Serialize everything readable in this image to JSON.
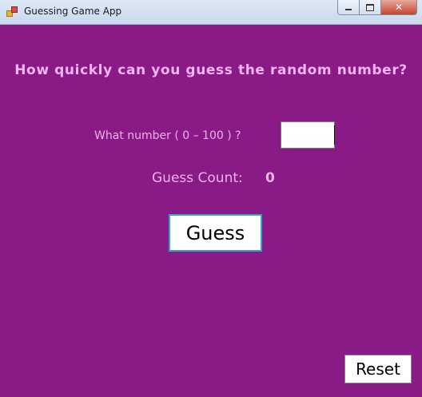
{
  "window": {
    "title": "Guessing Game App",
    "controls": {
      "minimize": "–",
      "maximize": "□",
      "close": "✕"
    },
    "background_color": "#8a1a86"
  },
  "main": {
    "headline": "How quickly can you guess the random number?",
    "prompt": "What number  ( 0 – 100 ) ?",
    "number_input": {
      "value": "",
      "placeholder": ""
    },
    "guess_count_label": "Guess Count:",
    "guess_count_value": "0",
    "guess_button_label": "Guess",
    "reset_button_label": "Reset"
  },
  "icons": [
    "app-icon",
    "minimize-icon",
    "maximize-icon",
    "close-icon"
  ]
}
